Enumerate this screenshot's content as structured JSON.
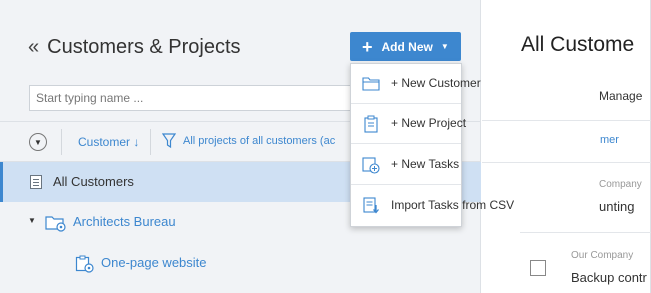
{
  "header": {
    "collapse_icon": "double-chevron-left-icon",
    "title": "Customers & Projects",
    "add_button": {
      "label": "Add New",
      "icon": "plus-icon",
      "caret": "caret-down-icon"
    }
  },
  "search": {
    "placeholder": "Start typing name ..."
  },
  "filter_bar": {
    "sort_label": "Customer ↓",
    "filter_label": "All projects of all customers (ac"
  },
  "tree": {
    "all_customers": "All Customers",
    "customer": "Architects Bureau",
    "project": "One-page website"
  },
  "right_panel": {
    "title": "All Custome",
    "manage": "Manage",
    "column": "mer",
    "company1": "Company",
    "task1": "unting",
    "company2": "Our Company",
    "task2": "Backup contr"
  },
  "menu": {
    "items": [
      {
        "label": "+ New Customer",
        "icon": "folder-icon"
      },
      {
        "label": "+ New Project",
        "icon": "clipboard-icon"
      },
      {
        "label": "+ New Tasks",
        "icon": "add-task-icon"
      },
      {
        "label": "Import Tasks from CSV",
        "icon": "import-csv-icon"
      }
    ]
  },
  "colors": {
    "accent": "#3d87cf",
    "selected_row": "#cfe0f3",
    "panel_bg": "#f1f3f6"
  }
}
